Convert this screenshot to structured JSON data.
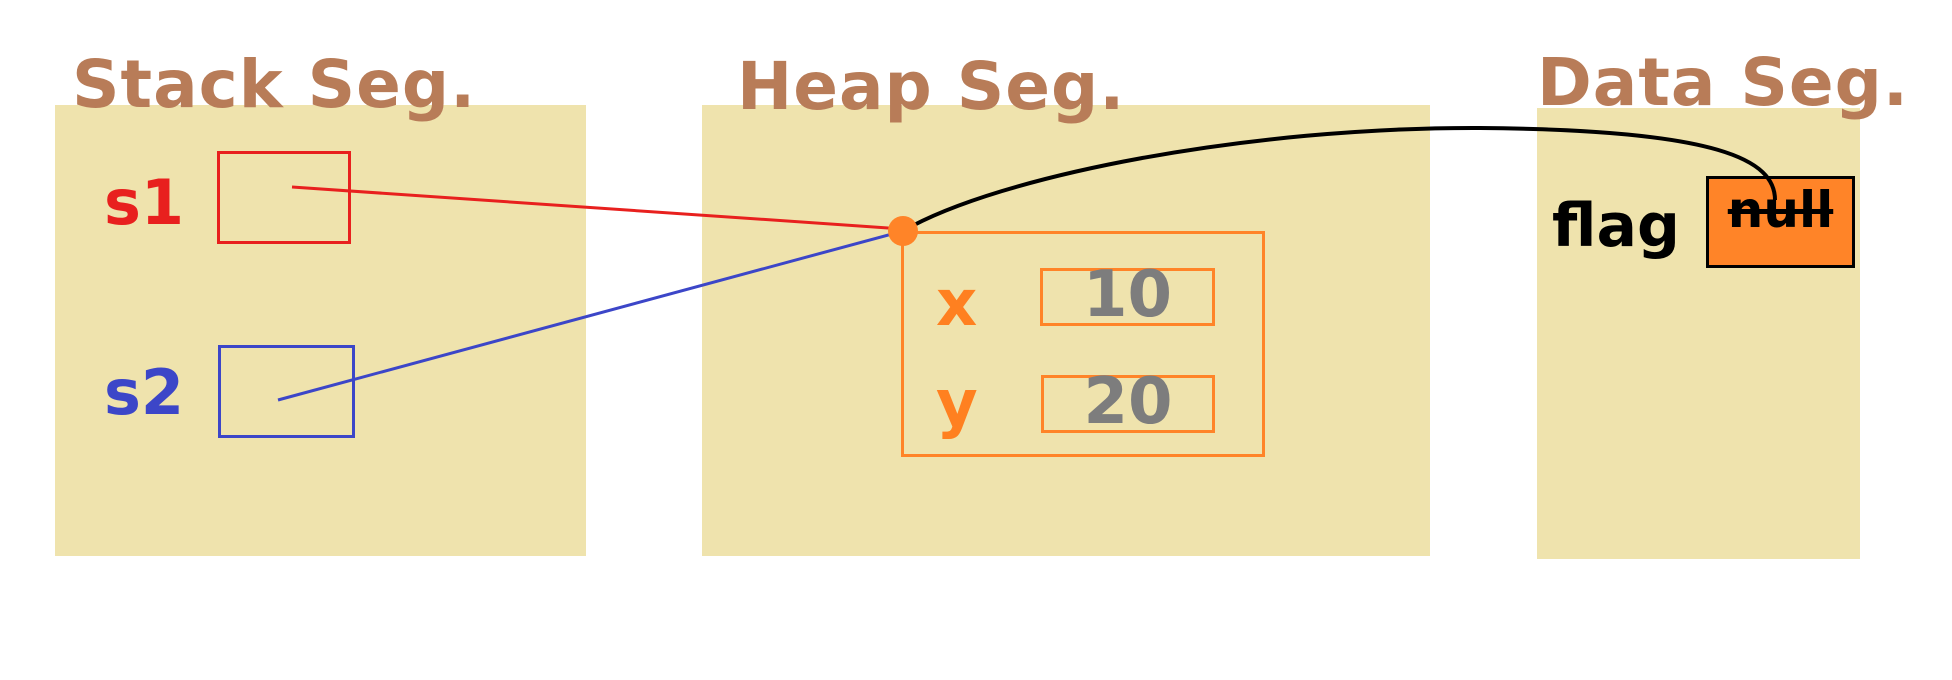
{
  "segments": {
    "stack": {
      "title": "Stack Seg."
    },
    "heap": {
      "title": "Heap Seg."
    },
    "data": {
      "title": "Data Seg."
    }
  },
  "stack": {
    "s1": {
      "label": "s1",
      "color": "#e8201e"
    },
    "s2": {
      "label": "s2",
      "color": "#3c46c8"
    }
  },
  "heap_object": {
    "fields": [
      {
        "name": "x",
        "value": "10"
      },
      {
        "name": "y",
        "value": "20"
      }
    ]
  },
  "data_segment": {
    "flag_label": "flag",
    "flag_value": "null"
  },
  "colors": {
    "segment_title": "#b87c58",
    "segment_panel": "#efe3ad",
    "heap_accent": "#ff8428",
    "field_value": "#7d7d7d",
    "reference_line": "#000000"
  }
}
